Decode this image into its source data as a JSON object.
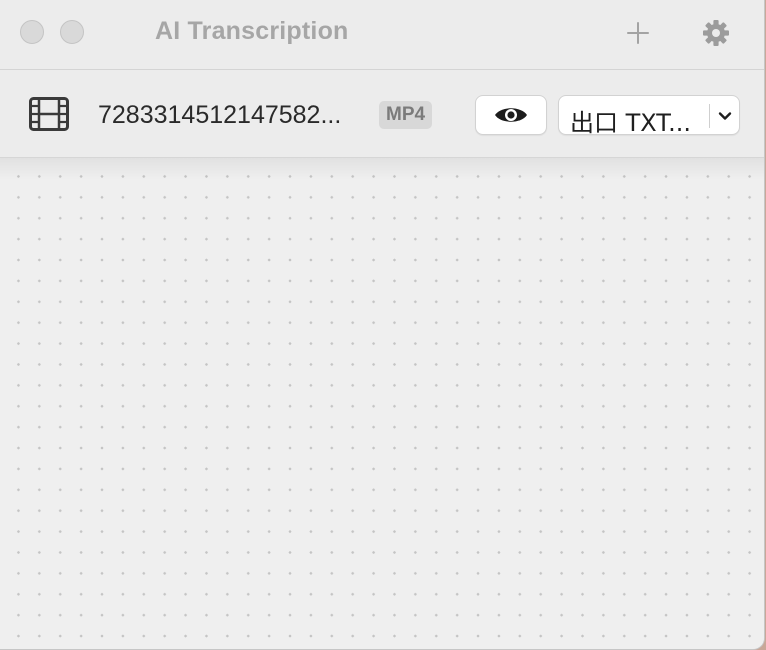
{
  "window": {
    "title": "AI Transcription"
  },
  "toolbar": {
    "add_icon": "plus-icon",
    "settings_icon": "gear-icon"
  },
  "file": {
    "icon": "film-icon",
    "name": "7283314512147582...",
    "format_badge": "MP4",
    "preview_icon": "eye-icon",
    "export_label": "出口 TXT...",
    "export_dropdown_icon": "chevron-down-icon"
  },
  "colors": {
    "window_bg": "#efefef",
    "titlebar_bg": "#ececec",
    "title_text": "#a6a6a6",
    "badge_bg": "#d8d8d8",
    "desktop_bg": "#c9a798"
  }
}
